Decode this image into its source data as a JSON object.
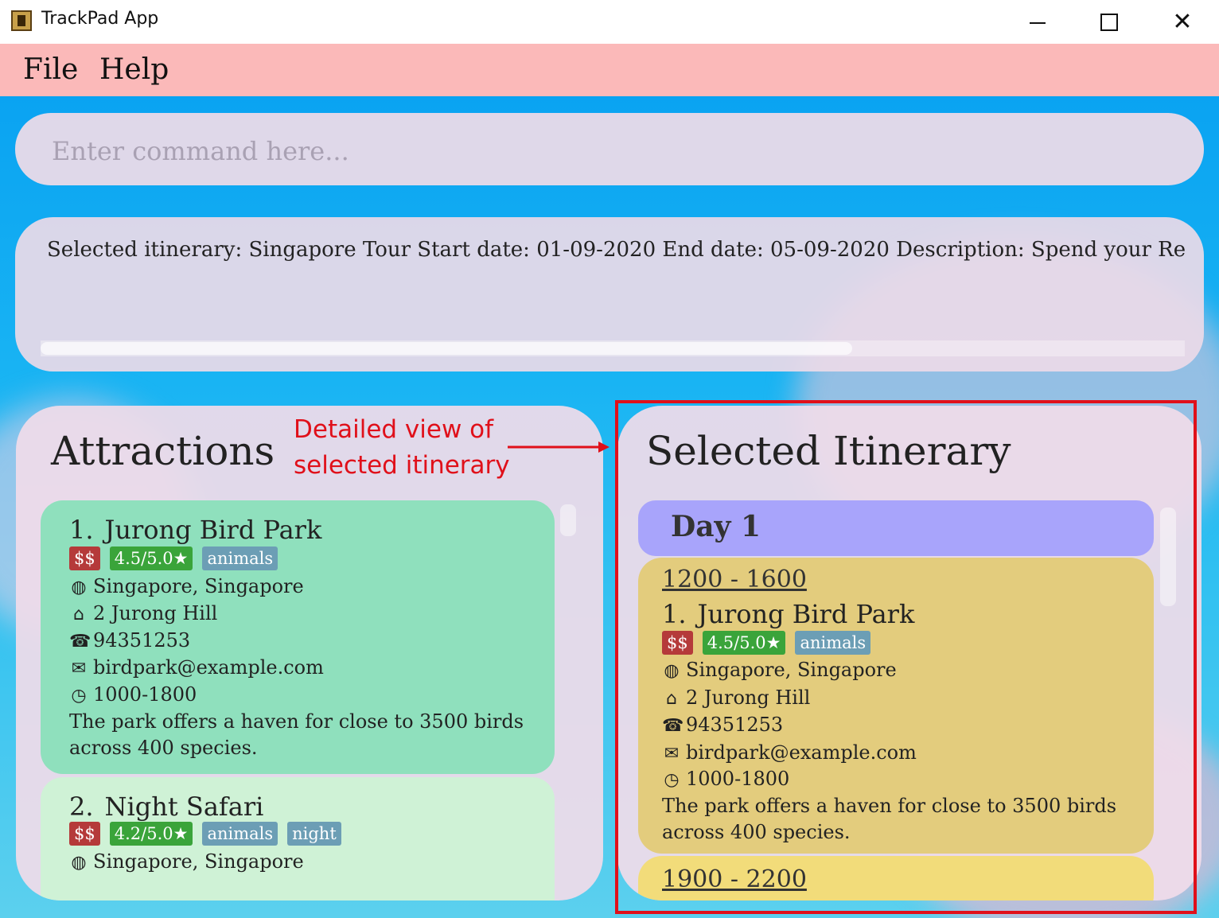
{
  "window": {
    "title": "TrackPad App"
  },
  "menu": {
    "file": "File",
    "help": "Help"
  },
  "command": {
    "placeholder": "Enter command here..."
  },
  "result": {
    "text": "Selected itinerary: Singapore Tour Start date: 01-09-2020 End date: 05-09-2020 Description: Spend your Rediscove"
  },
  "attractions": {
    "title": "Attractions",
    "items": [
      {
        "index": "1.",
        "name": "Jurong Bird Park",
        "price": "$$",
        "rating": "4.5/5.0★",
        "tags": [
          "animals"
        ],
        "location": "Singapore, Singapore",
        "address": "2 Jurong Hill",
        "phone": "94351253",
        "email": "birdpark@example.com",
        "hours": "1000-1800",
        "description": "The park offers a haven for close to 3500 birds across 400 species."
      },
      {
        "index": "2.",
        "name": "Night Safari",
        "price": "$$",
        "rating": "4.2/5.0★",
        "tags": [
          "animals",
          "night"
        ],
        "location": "Singapore, Singapore"
      }
    ]
  },
  "itinerary": {
    "title": "Selected Itinerary",
    "day_label": "Day 1",
    "slots": [
      {
        "time": "1200 - 1600",
        "index": "1.",
        "name": "Jurong Bird Park",
        "price": "$$",
        "rating": "4.5/5.0★",
        "tags": [
          "animals"
        ],
        "location": "Singapore, Singapore",
        "address": "2 Jurong Hill",
        "phone": "94351253",
        "email": "birdpark@example.com",
        "hours": "1000-1800",
        "description": "The park offers a haven for close to 3500 birds across 400 species."
      },
      {
        "time": "1900 - 2200"
      }
    ]
  },
  "annotation": {
    "line1": "Detailed view of",
    "line2": "selected itinerary"
  },
  "colors": {
    "menu_bg": "#fbb9b9",
    "card_1": "#8fe0bd",
    "card_2": "#cff2d6",
    "day_header": "#a8a4fb",
    "slot_1": "#e3cc7d",
    "slot_2": "#f2dc7a",
    "price_badge": "#b53a3a",
    "rating_badge": "#3aa43a",
    "tag_badge": "#6c9eb5",
    "annotation": "#e0101a"
  },
  "icons": [
    "globe-icon",
    "home-icon",
    "phone-icon",
    "email-icon",
    "clock-icon"
  ]
}
